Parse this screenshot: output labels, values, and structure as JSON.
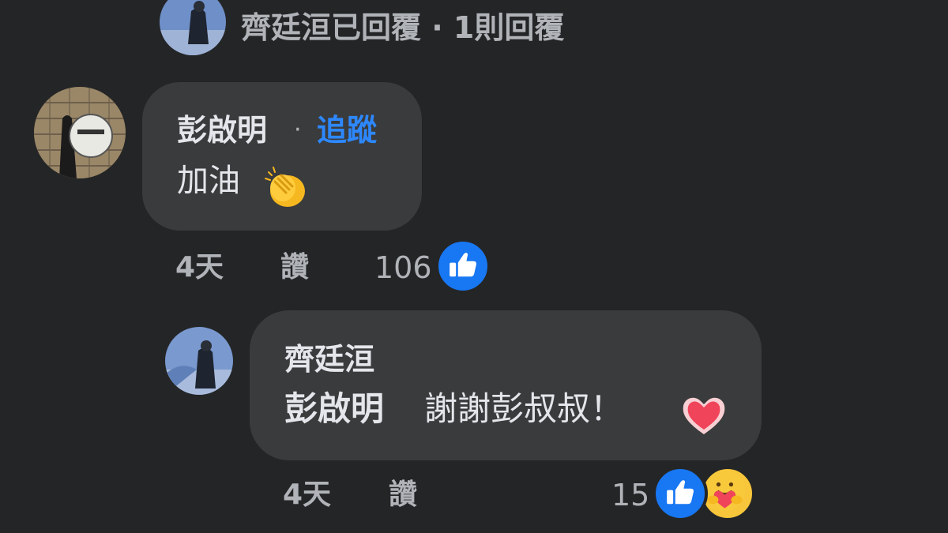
{
  "top_reply_summary": {
    "text": "齊廷洹已回覆 · 1則回覆"
  },
  "comment1": {
    "author": "彭啟明",
    "separator": "·",
    "follow_label": "追蹤",
    "text": "加油",
    "emoji": "clapping-hands",
    "time": "4天",
    "like_label": "讚",
    "reaction_count": "106",
    "reactions": [
      "like"
    ]
  },
  "reply1": {
    "author": "齊廷洹",
    "mention": "彭啟明",
    "text": "謝謝彭叔叔！",
    "emoji": "heart",
    "time": "4天",
    "like_label": "讚",
    "reaction_count": "15",
    "reactions": [
      "like",
      "care"
    ]
  },
  "colors": {
    "background": "#242526",
    "bubble": "#3a3b3c",
    "link_blue": "#2d88ff",
    "like_blue": "#1877f2",
    "text": "#e4e6eb",
    "muted": "#b0b3b8"
  }
}
